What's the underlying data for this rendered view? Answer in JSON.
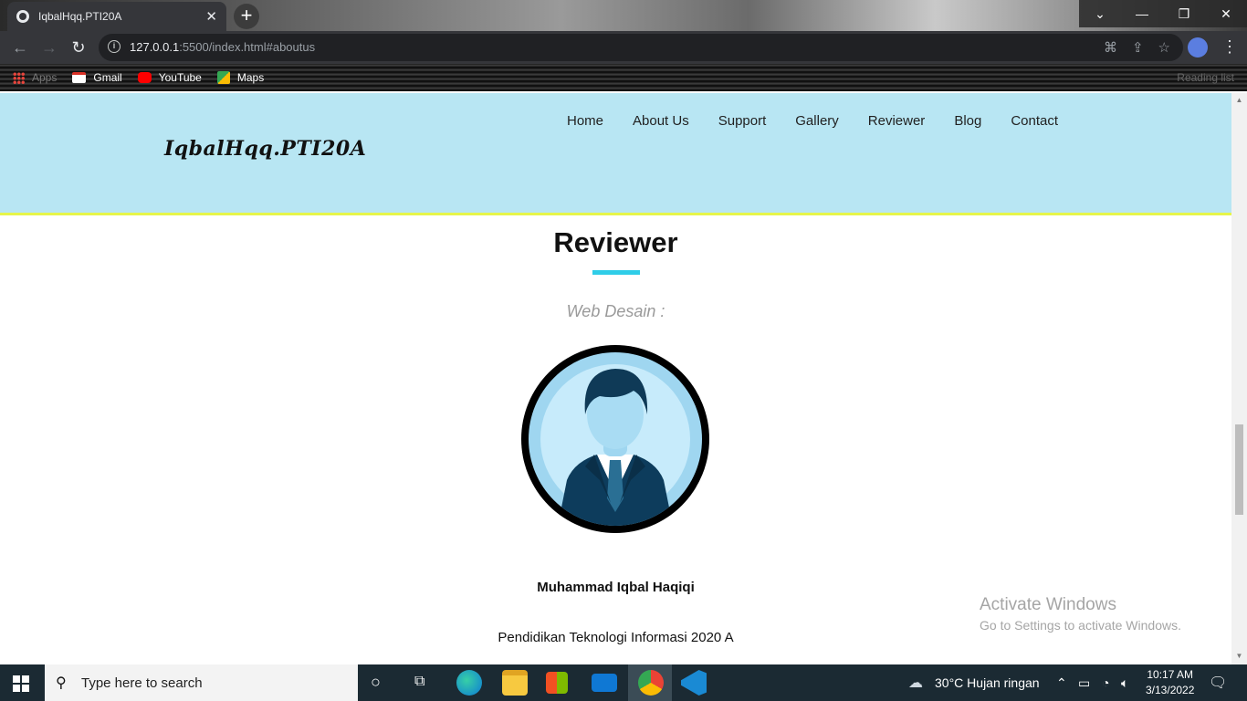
{
  "browser": {
    "tab_title": "IqbalHqq.PTI20A",
    "tab_close": "✕",
    "new_tab": "+",
    "url_host": "127.0.0.1",
    "url_rest": ":5500/index.html#aboutus",
    "window_controls": [
      "⌄",
      "—",
      "❐",
      "✕"
    ],
    "bookmarks": [
      {
        "label": "Apps",
        "icon": "apps-icon"
      },
      {
        "label": "Gmail",
        "icon": "gmail-icon"
      },
      {
        "label": "YouTube",
        "icon": "youtube-icon"
      },
      {
        "label": "Maps",
        "icon": "maps-icon"
      }
    ],
    "reading_list": "Reading list"
  },
  "site": {
    "logo": "IqbalHqq.PTI20A",
    "nav": [
      "Home",
      "About Us",
      "Support",
      "Gallery",
      "Reviewer",
      "Blog",
      "Contact"
    ],
    "section_title": "Reviewer",
    "subtitle": "Web Desain :",
    "reviewer_name": "Muhammad Iqbal Haqiqi",
    "reviewer_desc": "Pendidikan Teknologi Informasi 2020 A",
    "header_color": "#b8e6f3",
    "accent_color": "#2fcde8"
  },
  "watermark": {
    "line1": "Activate Windows",
    "line2": "Go to Settings to activate Windows."
  },
  "taskbar": {
    "search_placeholder": "Type here to search",
    "weather": "30°C  Hujan ringan",
    "time": "10:17 AM",
    "date": "3/13/2022"
  }
}
